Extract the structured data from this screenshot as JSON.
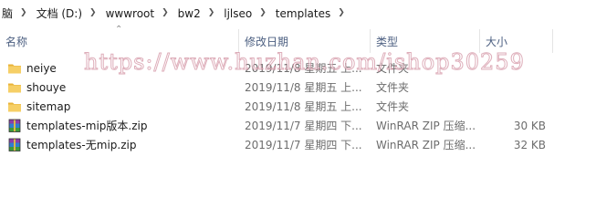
{
  "breadcrumb": {
    "items": [
      "脑",
      "文档 (D:)",
      "wwwroot",
      "bw2",
      "ljlseo",
      "templates"
    ]
  },
  "columns": {
    "name": "名称",
    "modified": "修改日期",
    "type": "类型",
    "size": "大小"
  },
  "files": [
    {
      "name": "neiye",
      "modified": "2019/11/8 星期五 上...",
      "type": "文件夹",
      "size": "",
      "icon": "folder-icon"
    },
    {
      "name": "shouye",
      "modified": "2019/11/8 星期五 上...",
      "type": "文件夹",
      "size": "",
      "icon": "folder-icon"
    },
    {
      "name": "sitemap",
      "modified": "2019/11/8 星期五 上...",
      "type": "文件夹",
      "size": "",
      "icon": "folder-icon"
    },
    {
      "name": "templates-mip版本.zip",
      "modified": "2019/11/7 星期四 下...",
      "type": "WinRAR ZIP 压缩...",
      "size": "30 KB",
      "icon": "winrar-archive-icon"
    },
    {
      "name": "templates-无mip.zip",
      "modified": "2019/11/7 星期四 下...",
      "type": "WinRAR ZIP 压缩...",
      "size": "32 KB",
      "icon": "winrar-archive-icon"
    }
  ],
  "watermark": "https://www.huzhan.com/ishop30259",
  "colors": {
    "header_text": "#4d6082",
    "folder": "#f2c55c",
    "meta_text": "#6d6d6d"
  }
}
